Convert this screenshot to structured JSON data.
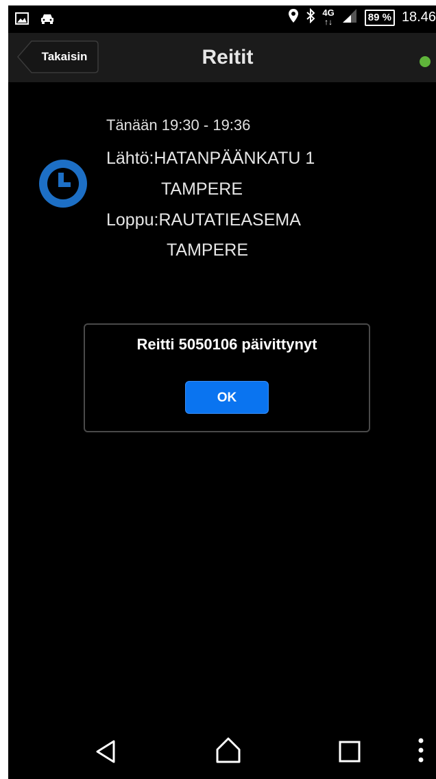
{
  "status_bar": {
    "left_icons": [
      "image-icon",
      "car-icon"
    ],
    "right_icons": [
      "location-icon",
      "bluetooth-icon",
      "network-4g-icon",
      "signal-icon"
    ],
    "network_label": "4G",
    "battery": "89 %",
    "time": "18.46"
  },
  "header": {
    "back_label": "Takaisin",
    "title": "Reitit",
    "status_dot_color": "#5fb43a"
  },
  "route": {
    "icon": "clock-icon",
    "icon_color": "#1d6fc5",
    "time": "Tänään 19:30 - 19:36",
    "start_line1": "Lähtö:HATANPÄÄNKATU 1",
    "start_line2": "TAMPERE",
    "end_line1": "Loppu:RAUTATIEASEMA",
    "end_line2": "TAMPERE"
  },
  "dialog": {
    "message": "Reitti 5050106 päivittynyt",
    "ok_label": "OK",
    "ok_color": "#0a74f0"
  },
  "nav_bar": {
    "items": [
      "back-icon",
      "home-icon",
      "recents-icon",
      "more-icon"
    ]
  }
}
